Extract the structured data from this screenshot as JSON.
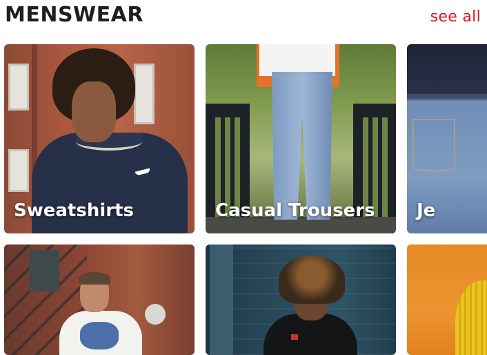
{
  "section": {
    "title": "MENSWEAR",
    "see_all_label": "see all"
  },
  "colors": {
    "accent": "#d9161f",
    "title": "#1e1e1e"
  },
  "categories": [
    {
      "label": "Sweatshirts"
    },
    {
      "label": "Casual Trousers"
    },
    {
      "label": "Je"
    },
    {
      "label": ""
    },
    {
      "label": ""
    },
    {
      "label": ""
    }
  ]
}
